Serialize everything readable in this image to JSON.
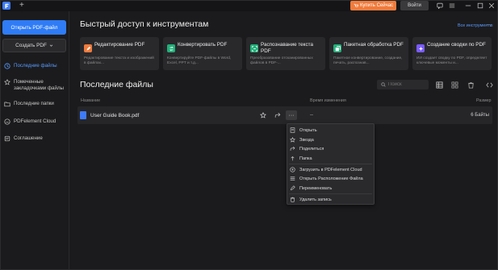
{
  "titlebar": {
    "new_tab": "+",
    "buy_label": "Купить Сейчас",
    "login_label": "Войти"
  },
  "sidebar": {
    "open_button": "Открыть PDF-файл",
    "create_button": "Создать PDF",
    "items": [
      {
        "label": "Последние файлы",
        "icon": "clock-icon",
        "active": true
      },
      {
        "label": "Помеченные закладочками файлы",
        "icon": "star-icon",
        "active": false
      },
      {
        "label": "Последние папки",
        "icon": "folder-icon",
        "active": false
      },
      {
        "label": "PDFelement Cloud",
        "icon": "cloud-icon",
        "active": false
      },
      {
        "label": "Соглашение",
        "icon": "agreement-icon",
        "active": false
      }
    ]
  },
  "quick_access": {
    "title": "Быстрый доступ к инструментам",
    "all_tools": "Все инструменты",
    "more": "···",
    "tools": [
      {
        "title": "Редактирование PDF",
        "desc": "Редактирование текста и изображений в файлах...",
        "color": "#f07b3c",
        "icon": "edit-icon"
      },
      {
        "title": "Конвертировать PDF",
        "desc": "Конвертируйте PDF-файлы в Word, Excel, PPT и т.д...",
        "color": "#22b07a",
        "icon": "convert-icon"
      },
      {
        "title": "Распознавание текста PDF",
        "desc": "Преобразование отсканированных файлов в PDF-...",
        "color": "#22b07a",
        "icon": "ocr-icon"
      },
      {
        "title": "Пакетная обработка PDF",
        "desc": "Пакетное конвертирование, создание, печать, распознав...",
        "color": "#22b07a",
        "icon": "batch-icon"
      },
      {
        "title": "Создание сводки по PDF",
        "desc": "ИИ создает сводку по PDF, определяет ключевые моменты и...",
        "color": "#7a5cff",
        "icon": "ai-summary-icon"
      }
    ]
  },
  "recent": {
    "title": "Последние файлы",
    "search_placeholder": "Поиск",
    "columns": {
      "name": "Название",
      "modified": "Время изменения",
      "size": "Размер"
    },
    "rows": [
      {
        "name": "User Guide Book.pdf",
        "modified": "--",
        "size": "6 Байты"
      }
    ]
  },
  "context_menu": {
    "items": [
      {
        "label": "Открыть",
        "icon": "open-icon"
      },
      {
        "label": "Звезда",
        "icon": "star-icon"
      },
      {
        "label": "Поделиться",
        "icon": "share-icon"
      },
      {
        "label": "Папка",
        "icon": "folder-up-icon"
      },
      {
        "label": "Загрузить в PDFelement Cloud",
        "icon": "cloud-upload-icon"
      },
      {
        "label": "Открыть Расположение Файла",
        "icon": "file-location-icon"
      },
      {
        "label": "Переименовать",
        "icon": "rename-icon"
      },
      {
        "label": "Удалить запись",
        "icon": "trash-icon"
      }
    ]
  },
  "colors": {
    "accent": "#2f7cf6",
    "buy": "#f07b3c",
    "background": "#1b1b1d",
    "card": "#29292c"
  }
}
